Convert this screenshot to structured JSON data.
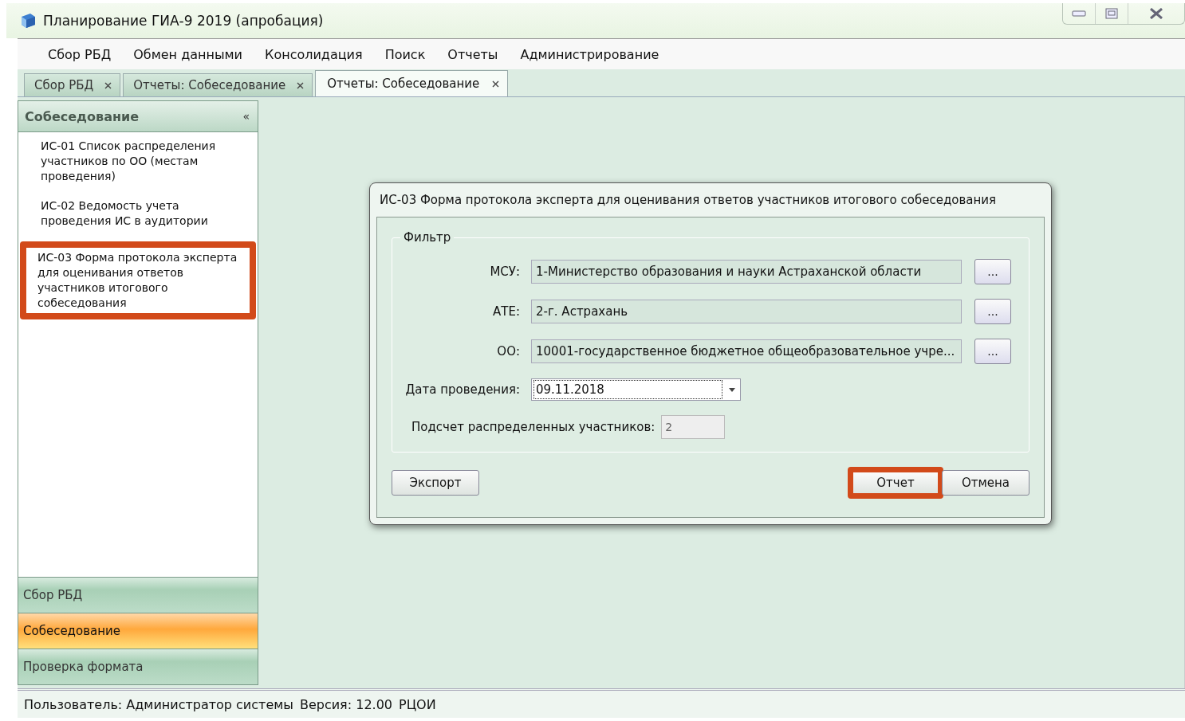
{
  "window": {
    "title": "Планирование ГИА-9 2019 (апробация)"
  },
  "menu": [
    "Сбор РБД",
    "Обмен данными",
    "Консолидация",
    "Поиск",
    "Отчеты",
    "Администрирование"
  ],
  "tabs": [
    {
      "label": "Сбор РБД",
      "selected": false
    },
    {
      "label": "Отчеты: Собеседование",
      "selected": false
    },
    {
      "label": "Отчеты: Собеседование",
      "selected": true
    }
  ],
  "sidebar": {
    "header": "Собеседование",
    "collapse": "«",
    "items": [
      {
        "label": "ИС-01 Список распределения участников по ОО (местам проведения)",
        "highlighted": false
      },
      {
        "label": "ИС-02 Ведомость учета проведения ИС в аудитории",
        "highlighted": false
      },
      {
        "label": "ИС-03 Форма протокола эксперта для оценивания ответов участников итогового собеседования",
        "highlighted": true
      }
    ],
    "sections": [
      {
        "label": "Сбор РБД",
        "selected": false
      },
      {
        "label": "Собеседование",
        "selected": true
      },
      {
        "label": "Проверка формата",
        "selected": false
      }
    ]
  },
  "dialog": {
    "title": "ИС-03 Форма протокола эксперта для оценивания ответов участников итогового собеседования",
    "group": "Фильтр",
    "fields": [
      {
        "kind": "lookup",
        "label": "МСУ:",
        "value": "1-Министерство образования и науки Астраханской области",
        "button": "..."
      },
      {
        "kind": "lookup",
        "label": "АТЕ:",
        "value": "2-г. Астрахань",
        "button": "..."
      },
      {
        "kind": "lookup",
        "label": "ОО:",
        "value": "10001-государственное бюджетное общеобразовательное учре...",
        "button": "..."
      },
      {
        "kind": "date",
        "label": "Дата проведения:",
        "value": "09.11.2018"
      },
      {
        "kind": "count",
        "label": "Подсчет распределенных участников:",
        "value": "2",
        "disabled": true
      }
    ],
    "buttons": [
      {
        "label": "Экспорт",
        "highlighted": false
      },
      {
        "label": "Отчет",
        "highlighted": true
      },
      {
        "label": "Отмена",
        "highlighted": false
      }
    ]
  },
  "status_bar": [
    "Пользователь: Администратор системы",
    "Версия: 12.00",
    "РЦОИ"
  ]
}
